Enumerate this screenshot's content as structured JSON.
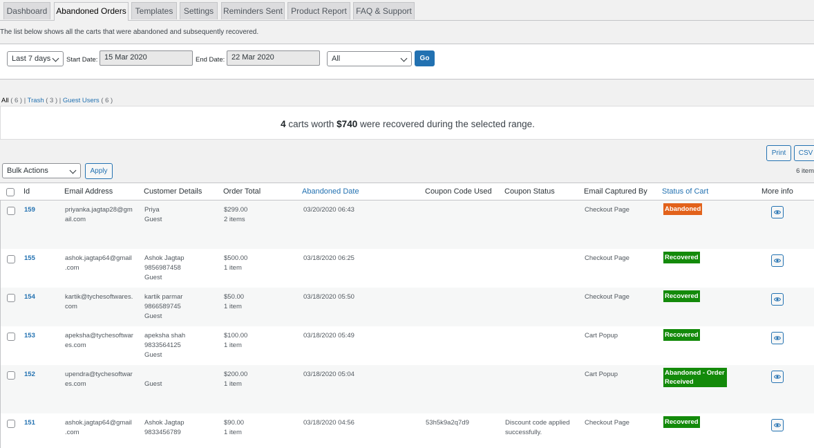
{
  "tabs": [
    "Dashboard",
    "Abandoned Orders",
    "Templates",
    "Settings",
    "Reminders Sent",
    "Product Report",
    "FAQ & Support"
  ],
  "intro": "The list below shows all the carts that were abandoned and subsequently recovered.",
  "filters": {
    "range": "Last 7 days",
    "start_label": "Start Date:",
    "start_value": "15 Mar 2020",
    "end_label": "End Date:",
    "end_value": "22 Mar 2020",
    "status": "All",
    "go": "Go"
  },
  "views": {
    "all": "All",
    "all_count": "( 6 )",
    "trash": "Trash",
    "trash_count": "( 3 )",
    "guest": "Guest Users",
    "guest_count": "( 6 )",
    "sep": "|"
  },
  "summary": {
    "count": "4",
    "text1": "carts worth",
    "amount": "$740",
    "text2": "were recovered during the selected range."
  },
  "actions": {
    "bulk": "Bulk Actions",
    "apply": "Apply",
    "print": "Print",
    "csv": "CSV",
    "items": "6 item"
  },
  "columns": {
    "id": "Id",
    "email": "Email Address",
    "customer": "Customer Details",
    "total": "Order Total",
    "date": "Abandoned Date",
    "coupon": "Coupon Code Used",
    "coupon_status": "Coupon Status",
    "captured": "Email Captured By",
    "status": "Status of Cart",
    "more": "More info"
  },
  "colors": {
    "abandoned": "#e2621b",
    "recovered": "#138a0a",
    "abandoned_order_received": "#138a0a",
    "link": "#2271b1"
  },
  "rows": [
    {
      "id": "159",
      "email1": "priyanka.jagtap28@gm",
      "email2": "ail.com",
      "cust1": "Priya",
      "cust2": "Guest",
      "cust3": "",
      "total": "$299.00",
      "items": "2 items",
      "date": "03/20/2020 06:43",
      "coupon": "",
      "cs1": "",
      "cs2": "",
      "captured": "Checkout Page",
      "status1": "Abandoned",
      "status2": "",
      "status_key": "abandoned",
      "eye": "eye-icon"
    },
    {
      "id": "155",
      "email1": "ashok.jagtap64@gmail",
      "email2": ".com",
      "cust1": "Ashok Jagtap",
      "cust2": "9856987458",
      "cust3": "Guest",
      "total": "$500.00",
      "items": "1 item",
      "date": "03/18/2020 06:25",
      "coupon": "",
      "cs1": "",
      "cs2": "",
      "captured": "Checkout Page",
      "status1": "Recovered",
      "status2": "",
      "status_key": "recovered",
      "eye": "eye-icon"
    },
    {
      "id": "154",
      "email1": "kartik@tychesoftwares.",
      "email2": "com",
      "cust1": "kartik parmar",
      "cust2": "9866589745",
      "cust3": "Guest",
      "total": "$50.00",
      "items": "1 item",
      "date": "03/18/2020 05:50",
      "coupon": "",
      "cs1": "",
      "cs2": "",
      "captured": "Checkout Page",
      "status1": "Recovered",
      "status2": "",
      "status_key": "recovered",
      "eye": "eye-icon"
    },
    {
      "id": "153",
      "email1": "apeksha@tychesoftwar",
      "email2": "es.com",
      "cust1": "apeksha shah",
      "cust2": "9833564125",
      "cust3": "Guest",
      "total": "$100.00",
      "items": "1 item",
      "date": "03/18/2020 05:49",
      "coupon": "",
      "cs1": "",
      "cs2": "",
      "captured": "Cart Popup",
      "status1": "Recovered",
      "status2": "",
      "status_key": "recovered",
      "eye": "eye-icon"
    },
    {
      "id": "152",
      "email1": "upendra@tychesoftwar",
      "email2": "es.com",
      "cust1": "",
      "cust2": "Guest",
      "cust3": "",
      "total": "$200.00",
      "items": "1 item",
      "date": "03/18/2020 05:04",
      "coupon": "",
      "cs1": "",
      "cs2": "",
      "captured": "Cart Popup",
      "status1": "Abandoned - Order",
      "status2": "Received",
      "status_key": "abandoned_order_received",
      "eye": "eye-icon"
    },
    {
      "id": "151",
      "email1": "ashok.jagtap64@gmail",
      "email2": ".com",
      "cust1": "Ashok Jagtap",
      "cust2": "9833456789",
      "cust3": "",
      "total": "$90.00",
      "items": "1 item",
      "date": "03/18/2020 04:56",
      "coupon": "53h5k9a2q7d9",
      "cs1": "Discount code applied",
      "cs2": "successfully.",
      "captured": "Checkout Page",
      "status1": "Recovered",
      "status2": "",
      "status_key": "recovered",
      "eye": "eye-icon"
    }
  ]
}
